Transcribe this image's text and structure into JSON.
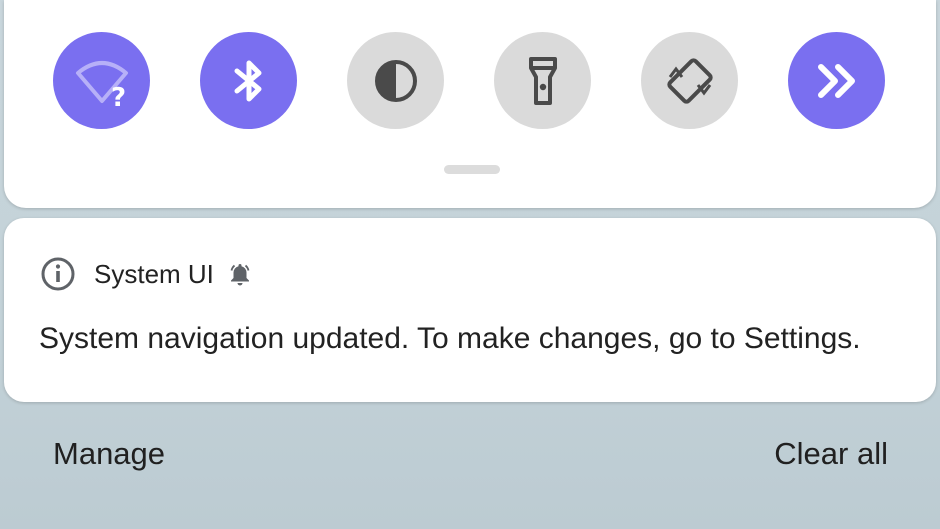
{
  "quick_settings": {
    "tiles": [
      {
        "icon": "wifi-unknown-icon",
        "state": "on"
      },
      {
        "icon": "bluetooth-icon",
        "state": "on"
      },
      {
        "icon": "dark-theme-icon",
        "state": "off"
      },
      {
        "icon": "flashlight-icon",
        "state": "off"
      },
      {
        "icon": "auto-rotate-icon",
        "state": "off"
      },
      {
        "icon": "double-chevron-right-icon",
        "state": "on"
      }
    ],
    "accent_color": "#7a6ff0",
    "inactive_color": "#dadada"
  },
  "notification": {
    "app_name": "System UI",
    "app_icon": "info-icon",
    "alert_icon": "bell-icon",
    "text": "System navigation updated. To make changes, go to Settings."
  },
  "footer": {
    "manage_label": "Manage",
    "clear_all_label": "Clear all"
  }
}
